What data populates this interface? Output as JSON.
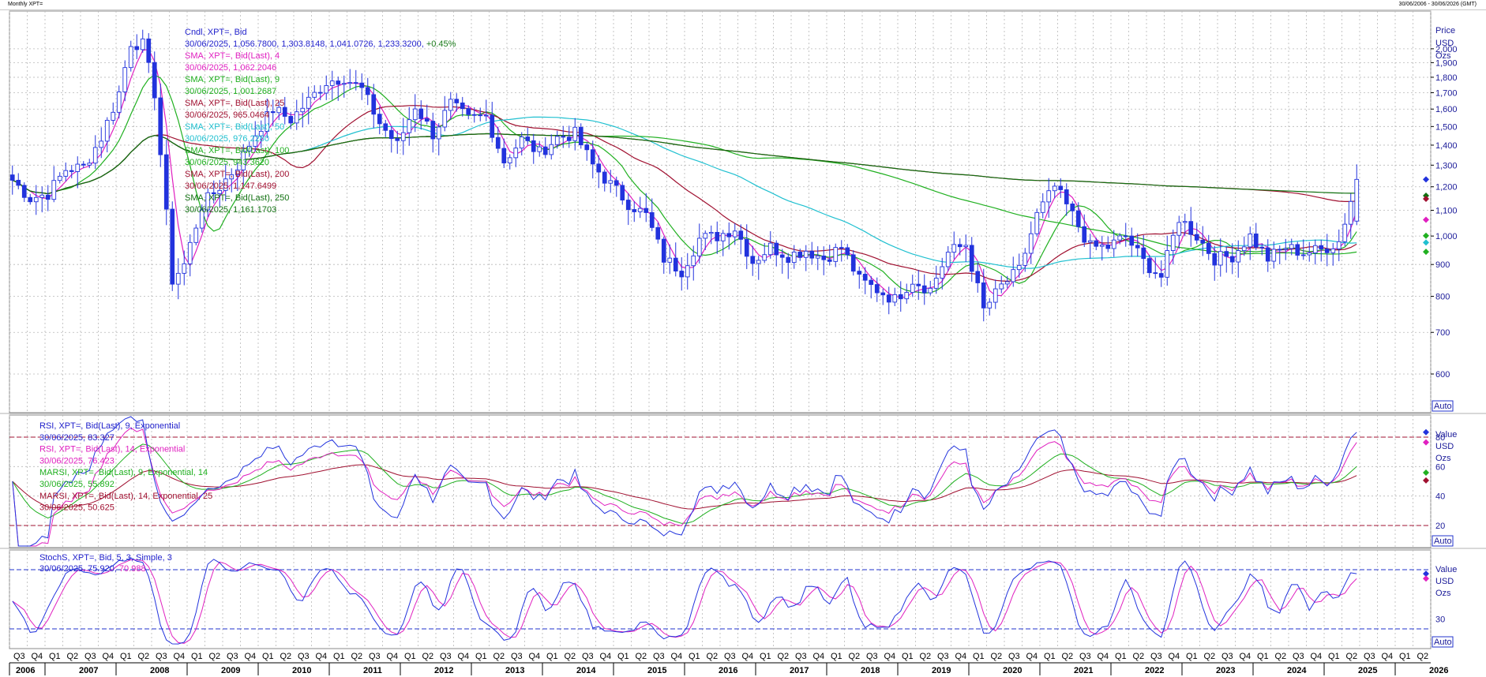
{
  "window": {
    "title": "Monthly XPT=",
    "date_range": "30/06/2006 - 30/06/2026 (GMT)"
  },
  "auto_label": "Auto",
  "price_axis_units": [
    "Price",
    "USD",
    "Ozs"
  ],
  "indicator_axis_units": [
    "Value",
    "USD",
    "Ozs"
  ],
  "legend_main": [
    {
      "text": "Cndl, XPT=, Bid",
      "color": "#2222cc"
    },
    {
      "text": "30/06/2025, 1,056.7800, 1,303.8148, 1,041.0726, 1,233.3200,",
      "color": "#2222cc",
      "extra": "+0.45%",
      "extra_color": "#1a7a1a"
    },
    {
      "text": "SMA, XPT=, Bid(Last),  4",
      "color": "#e020c0"
    },
    {
      "text": "30/06/2025, 1,062.2046",
      "color": "#e020c0"
    },
    {
      "text": "SMA, XPT=, Bid(Last),  9",
      "color": "#20b020"
    },
    {
      "text": "30/06/2025, 1,001.2687",
      "color": "#20b020"
    },
    {
      "text": "SMA, XPT=, Bid(Last),  25",
      "color": "#a01030"
    },
    {
      "text": "30/06/2025, 965.0464",
      "color": "#a01030"
    },
    {
      "text": "SMA, XPT=, Bid(Last),  50",
      "color": "#20c0d0"
    },
    {
      "text": "30/06/2025, 976.2280",
      "color": "#20c0d0"
    },
    {
      "text": "SMA, XPT=, Bid(Last),  100",
      "color": "#20b020"
    },
    {
      "text": "30/06/2025, 943.3620",
      "color": "#20b020"
    },
    {
      "text": "SMA, XPT=, Bid(Last),  200",
      "color": "#a01030"
    },
    {
      "text": "30/06/2025, 1,147.6499",
      "color": "#a01030"
    },
    {
      "text": "SMA, XPT=, Bid(Last),  250",
      "color": "#107010"
    },
    {
      "text": "30/06/2025, 1,161.1703",
      "color": "#107010"
    }
  ],
  "legend_rsi": [
    {
      "text": "RSI, XPT=, Bid(Last),  9, Exponential",
      "color": "#2222cc"
    },
    {
      "text": "30/06/2025, 83.327",
      "color": "#2222cc"
    },
    {
      "text": "RSI, XPT=, Bid(Last),  14, Exponential",
      "color": "#e020c0"
    },
    {
      "text": "30/06/2025, 76.423",
      "color": "#e020c0"
    },
    {
      "text": "MARSI, XPT=, Bid(Last),  9, Exponential, 14",
      "color": "#20b020"
    },
    {
      "text": "30/06/2025, 55.892",
      "color": "#20b020"
    },
    {
      "text": "MARSI, XPT=, Bid(Last),  14, Exponential, 25",
      "color": "#a01030"
    },
    {
      "text": "30/06/2025, 50.625",
      "color": "#a01030"
    }
  ],
  "legend_stoch": [
    {
      "text": "StochS, XPT=, Bid,  5, 3, Simple, 3",
      "color": "#2222cc"
    },
    {
      "text": "30/06/2025, 75.920,",
      "color": "#2222cc",
      "extra": "70.988",
      "extra_color": "#e020c0"
    }
  ],
  "colors": {
    "candle_up": "#ffffff",
    "candle_down": "#2233dd",
    "sma4": "#e020c0",
    "sma9": "#20b020",
    "sma25": "#a01030",
    "sma50": "#20c0d0",
    "sma100": "#20b020",
    "sma200": "#a01030",
    "sma250": "#107010",
    "ref_line": "#a01030",
    "grid": "#b8b8b8"
  },
  "chart_data": [
    {
      "type": "candlestick",
      "title": "Cndl, XPT=, Bid",
      "ylabel": "Price USD Ozs",
      "yscale": "log",
      "ylim": [
        520,
        2300
      ],
      "yticks": [
        600,
        700,
        800,
        900,
        1000,
        1100,
        1200,
        1300,
        1400,
        1500,
        1600,
        1700,
        1800,
        1900,
        2000
      ],
      "ytick_labels": [
        "600",
        "700",
        "800",
        "900",
        "1,000",
        "1,100",
        "1,200",
        "1,300",
        "1,400",
        "1,500",
        "1,600",
        "1,700",
        "1,800",
        "1,900",
        "2,000"
      ],
      "x_start": "2006-07",
      "x_end": "2026-06",
      "close_series": {
        "dates": [
          "2006-07",
          "2006-10",
          "2007-01",
          "2007-04",
          "2007-07",
          "2007-10",
          "2008-01",
          "2008-03",
          "2008-05",
          "2008-07",
          "2008-09",
          "2008-10",
          "2008-12",
          "2009-03",
          "2009-06",
          "2009-09",
          "2009-12",
          "2010-03",
          "2010-06",
          "2010-09",
          "2010-12",
          "2011-03",
          "2011-06",
          "2011-09",
          "2011-12",
          "2012-03",
          "2012-06",
          "2012-09",
          "2012-12",
          "2013-03",
          "2013-06",
          "2013-09",
          "2013-12",
          "2014-03",
          "2014-06",
          "2014-09",
          "2014-12",
          "2015-03",
          "2015-06",
          "2015-09",
          "2015-12",
          "2016-03",
          "2016-06",
          "2016-09",
          "2016-12",
          "2017-03",
          "2017-06",
          "2017-09",
          "2017-12",
          "2018-03",
          "2018-06",
          "2018-09",
          "2018-12",
          "2019-03",
          "2019-06",
          "2019-09",
          "2019-12",
          "2020-03",
          "2020-06",
          "2020-09",
          "2020-12",
          "2021-03",
          "2021-06",
          "2021-09",
          "2021-12",
          "2022-03",
          "2022-06",
          "2022-09",
          "2022-12",
          "2023-03",
          "2023-06",
          "2023-09",
          "2023-12",
          "2024-03",
          "2024-06",
          "2024-09",
          "2024-12",
          "2025-03",
          "2025-06"
        ],
        "values": [
          1230,
          1150,
          1170,
          1280,
          1290,
          1440,
          1700,
          2050,
          2030,
          1700,
          1080,
          850,
          900,
          1120,
          1200,
          1300,
          1460,
          1600,
          1540,
          1650,
          1770,
          1800,
          1720,
          1520,
          1400,
          1620,
          1460,
          1630,
          1540,
          1560,
          1320,
          1430,
          1360,
          1440,
          1460,
          1300,
          1210,
          1130,
          1080,
          920,
          880,
          990,
          1000,
          1030,
          910,
          960,
          930,
          950,
          920,
          960,
          850,
          820,
          790,
          850,
          820,
          940,
          970,
          760,
          830,
          880,
          1080,
          1200,
          1080,
          960,
          960,
          1000,
          910,
          860,
          1070,
          1000,
          920,
          930,
          1000,
          920,
          960,
          940,
          950,
          980,
          1233
        ]
      },
      "last_bar": {
        "date": "30/06/2025",
        "open": 1056.78,
        "high": 1303.8148,
        "low": 1041.0726,
        "close": 1233.32,
        "change": "+0.45%"
      },
      "series": [
        {
          "name": "SMA, XPT=, Bid(Last), 4",
          "last": 1062.2046
        },
        {
          "name": "SMA, XPT=, Bid(Last), 9",
          "last": 1001.2687
        },
        {
          "name": "SMA, XPT=, Bid(Last), 25",
          "last": 965.0464
        },
        {
          "name": "SMA, XPT=, Bid(Last), 50",
          "last": 976.228
        },
        {
          "name": "SMA, XPT=, Bid(Last), 100",
          "last": 943.362
        },
        {
          "name": "SMA, XPT=, Bid(Last), 200",
          "last": 1147.6499
        },
        {
          "name": "SMA, XPT=, Bid(Last), 250",
          "last": 1161.1703
        }
      ]
    },
    {
      "type": "line",
      "title": "RSI",
      "ylim": [
        5,
        95
      ],
      "yticks": [
        20,
        40,
        60,
        80
      ],
      "ytick_labels": [
        "20",
        "40",
        "60",
        "80"
      ],
      "reference_lines": [
        80,
        20
      ],
      "series": [
        {
          "name": "RSI, XPT=, Bid(Last), 9, Exponential",
          "last": 83.327
        },
        {
          "name": "RSI, XPT=, Bid(Last), 14, Exponential",
          "last": 76.423
        },
        {
          "name": "MARSI, XPT=, Bid(Last), 9, Exponential, 14",
          "last": 55.892
        },
        {
          "name": "MARSI, XPT=, Bid(Last), 14, Exponential, 25",
          "last": 50.625
        }
      ]
    },
    {
      "type": "line",
      "title": "StochS",
      "ylim": [
        0,
        100
      ],
      "yticks": [
        30
      ],
      "ytick_labels": [
        "30"
      ],
      "reference_lines": [
        80,
        20
      ],
      "series": [
        {
          "name": "StochS, XPT=, Bid, 5, 3, Simple, 3 (%K)",
          "last": 75.92
        },
        {
          "name": "StochS, XPT=, Bid, 5, 3, Simple, 3 (%D)",
          "last": 70.988
        }
      ]
    }
  ],
  "x_axis": {
    "quarters": [
      "Q3",
      "Q4",
      "Q1",
      "Q2",
      "Q3",
      "Q4",
      "Q1",
      "Q2",
      "Q3",
      "Q4",
      "Q1",
      "Q2",
      "Q3",
      "Q4",
      "Q1",
      "Q2",
      "Q3",
      "Q4",
      "Q1",
      "Q2",
      "Q3",
      "Q4",
      "Q1",
      "Q2",
      "Q3",
      "Q4",
      "Q1",
      "Q2",
      "Q3",
      "Q4",
      "Q1",
      "Q2",
      "Q3",
      "Q4",
      "Q1",
      "Q2",
      "Q3",
      "Q4",
      "Q1",
      "Q2",
      "Q3",
      "Q4",
      "Q1",
      "Q2",
      "Q3",
      "Q4",
      "Q1",
      "Q2",
      "Q3",
      "Q4",
      "Q1",
      "Q2",
      "Q3",
      "Q4",
      "Q1",
      "Q2",
      "Q3",
      "Q4",
      "Q1",
      "Q2",
      "Q3",
      "Q4",
      "Q1",
      "Q2",
      "Q3",
      "Q4",
      "Q1",
      "Q2",
      "Q3",
      "Q4",
      "Q1",
      "Q2",
      "Q3",
      "Q4",
      "Q1",
      "Q2",
      "Q3",
      "Q4",
      "Q1",
      "Q2"
    ],
    "years": [
      "2006",
      "2007",
      "2008",
      "2009",
      "2010",
      "2011",
      "2012",
      "2013",
      "2014",
      "2015",
      "2016",
      "2017",
      "2018",
      "2019",
      "2020",
      "2021",
      "2022",
      "2023",
      "2024",
      "2025",
      "2026"
    ]
  }
}
